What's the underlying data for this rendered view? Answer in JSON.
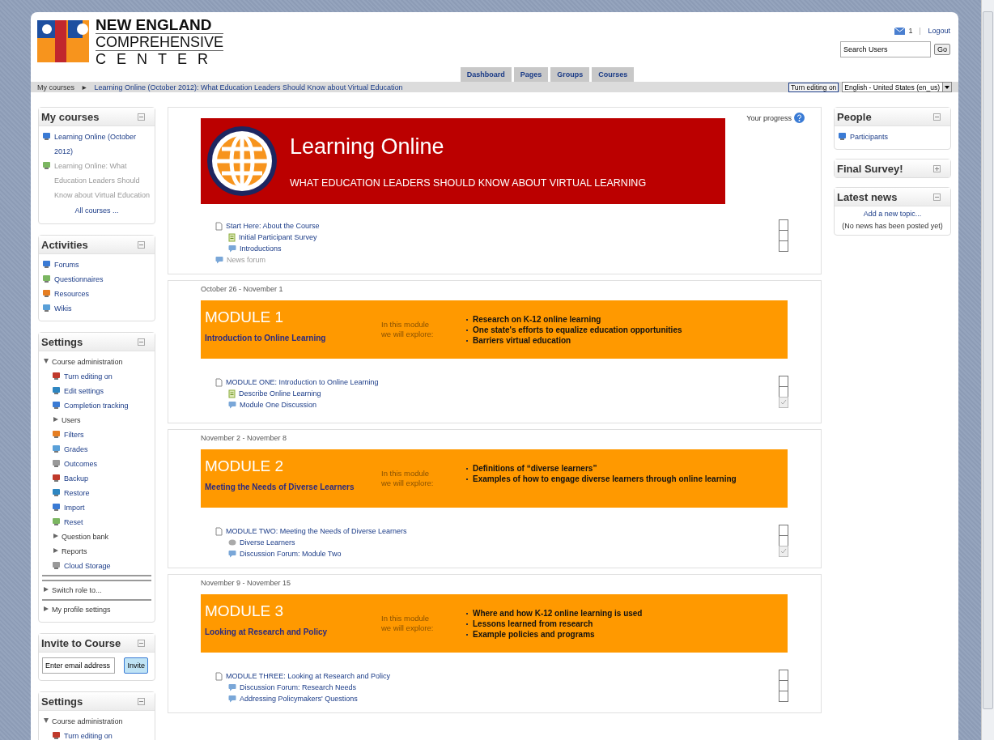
{
  "header": {
    "logo_lines": [
      "NEW ENGLAND",
      "COMPREHENSIVE",
      "CENTER"
    ],
    "messages_count": "1",
    "logout": "Logout",
    "search": {
      "placeholder": "Search Users"
    },
    "go": "Go"
  },
  "tabs": [
    "Dashboard",
    "Pages",
    "Groups",
    "Courses"
  ],
  "breadcrumb": {
    "items": [
      "My courses",
      "Learning Online (October 2012): What Education Leaders Should Know about Virtual Education"
    ],
    "separator": "►",
    "edit_button": "Turn editing on",
    "language": "English - United States (en_us)"
  },
  "left_blocks": [
    {
      "title": "My courses",
      "collapsed": false,
      "items": [
        {
          "kind": "course",
          "label": "Learning Online (October 2012)",
          "dimmed": false
        },
        {
          "kind": "course",
          "label": "Learning Online: What Education Leaders Should Know about Virtual Education",
          "dimmed": true
        }
      ],
      "footer_link": "All courses ..."
    },
    {
      "title": "Activities",
      "collapsed": false,
      "items": [
        {
          "kind": "link",
          "label": "Forums",
          "dimmed": false
        },
        {
          "kind": "link",
          "label": "Questionnaires",
          "dimmed": false
        },
        {
          "kind": "link",
          "label": "Resources",
          "dimmed": false
        },
        {
          "kind": "link",
          "label": "Wikis",
          "dimmed": false
        }
      ]
    },
    {
      "title": "Settings",
      "collapsed": false,
      "items": [
        {
          "kind": "branch",
          "label": "Course administration",
          "expanded": true,
          "children": [
            {
              "kind": "link",
              "label": "Turn editing on"
            },
            {
              "kind": "link",
              "label": "Edit settings"
            },
            {
              "kind": "link",
              "label": "Completion tracking"
            },
            {
              "kind": "branch",
              "label": "Users",
              "expanded": false
            },
            {
              "kind": "link",
              "label": "Filters"
            },
            {
              "kind": "link",
              "label": "Grades"
            },
            {
              "kind": "link",
              "label": "Outcomes"
            },
            {
              "kind": "link",
              "label": "Backup"
            },
            {
              "kind": "link",
              "label": "Restore"
            },
            {
              "kind": "link",
              "label": "Import"
            },
            {
              "kind": "link",
              "label": "Reset"
            },
            {
              "kind": "branch",
              "label": "Question bank",
              "expanded": false
            },
            {
              "kind": "branch",
              "label": "Reports",
              "expanded": false
            },
            {
              "kind": "link",
              "label": "Cloud Storage"
            }
          ]
        },
        {
          "kind": "branch",
          "label": "Switch role to...",
          "expanded": false
        },
        {
          "kind": "branch",
          "label": "My profile settings",
          "expanded": false
        }
      ]
    },
    {
      "title": "Invite to Course",
      "collapsed": false,
      "kind": "invite",
      "input": {
        "placeholder": "Enter email address"
      },
      "button": "Invite"
    },
    {
      "title": "Settings",
      "collapsed": false,
      "items": [
        {
          "kind": "branch",
          "label": "Course administration",
          "expanded": true,
          "children": [
            {
              "kind": "link",
              "label": "Turn editing on"
            }
          ]
        }
      ]
    }
  ],
  "course": {
    "progress_label": "Your progress",
    "banner": {
      "title": "Learning Online",
      "subtitle": "WHAT EDUCATION LEADERS SHOULD KNOW ABOUT VIRTUAL LEARNING"
    },
    "intro_activities": [
      {
        "kind": "page",
        "label": "Start Here: About the Course",
        "dimmed": false,
        "children": [
          {
            "kind": "survey",
            "label": "Initial Participant Survey",
            "dimmed": false
          },
          {
            "kind": "forum",
            "label": "Introductions",
            "dimmed": false
          }
        ]
      },
      {
        "kind": "forum",
        "label": "News forum",
        "dimmed": true
      }
    ],
    "intro_completion": [
      {
        "checked": false
      },
      {
        "checked": false
      },
      {
        "checked": false
      }
    ],
    "modules": [
      {
        "dates": "October 26 - November 1",
        "title": "MODULE 1",
        "subtitle": "Introduction to Online Learning",
        "intro": "In this module\nwe will explore:",
        "topics": [
          "Research on K-12 online learning",
          "One state's efforts to equalize education opportunities",
          "Barriers virtual education"
        ],
        "activities": [
          {
            "kind": "page",
            "label": "MODULE ONE: Introduction to Online Learning",
            "dimmed": false,
            "children": [
              {
                "kind": "survey",
                "label": "Describe Online Learning",
                "dimmed": false
              },
              {
                "kind": "forum",
                "label": "Module One Discussion",
                "dimmed": false
              }
            ]
          }
        ],
        "completion": [
          {
            "checked": false
          },
          {
            "checked": false
          },
          {
            "checked": true
          }
        ]
      },
      {
        "dates": "November 2 - November 8",
        "title": "MODULE 2",
        "subtitle": "Meeting the Needs of Diverse Learners",
        "intro": "In this module\nwe will explore:",
        "topics": [
          "Definitions of “diverse learners”",
          "Examples of how to engage diverse learners through online learning"
        ],
        "activities": [
          {
            "kind": "page",
            "label": "MODULE TWO: Meeting the Needs of Diverse Learners",
            "dimmed": false,
            "children": [
              {
                "kind": "wiki",
                "label": "Diverse Learners",
                "dimmed": false
              },
              {
                "kind": "forum",
                "label": "Discussion Forum: Module Two",
                "dimmed": false
              }
            ]
          }
        ],
        "completion": [
          {
            "checked": false
          },
          {
            "checked": false
          },
          {
            "checked": true
          }
        ]
      },
      {
        "dates": "November 9 - November 15",
        "title": "MODULE 3",
        "subtitle": "Looking at Research and Policy",
        "intro": "In this module\nwe will explore:",
        "topics": [
          "Where and how K-12 online learning is used",
          "Lessons learned from research",
          "Example policies and  programs"
        ],
        "activities": [
          {
            "kind": "page",
            "label": "MODULE THREE: Looking at Research and Policy",
            "dimmed": false,
            "children": [
              {
                "kind": "forum",
                "label": "Discussion Forum: Research Needs",
                "dimmed": false
              },
              {
                "kind": "forum",
                "label": "Addressing Policymakers' Questions",
                "dimmed": false
              }
            ]
          }
        ],
        "completion": [
          {
            "checked": false
          },
          {
            "checked": false
          },
          {
            "checked": false
          }
        ]
      }
    ]
  },
  "right_blocks": [
    {
      "title": "People",
      "collapsed": false,
      "items": [
        {
          "kind": "people",
          "label": "Participants"
        }
      ]
    },
    {
      "title": "Final Survey!",
      "collapsed": true
    },
    {
      "title": "Latest news",
      "collapsed": false,
      "link": "Add a new topic...",
      "note": "(No news has been posted yet)"
    }
  ]
}
